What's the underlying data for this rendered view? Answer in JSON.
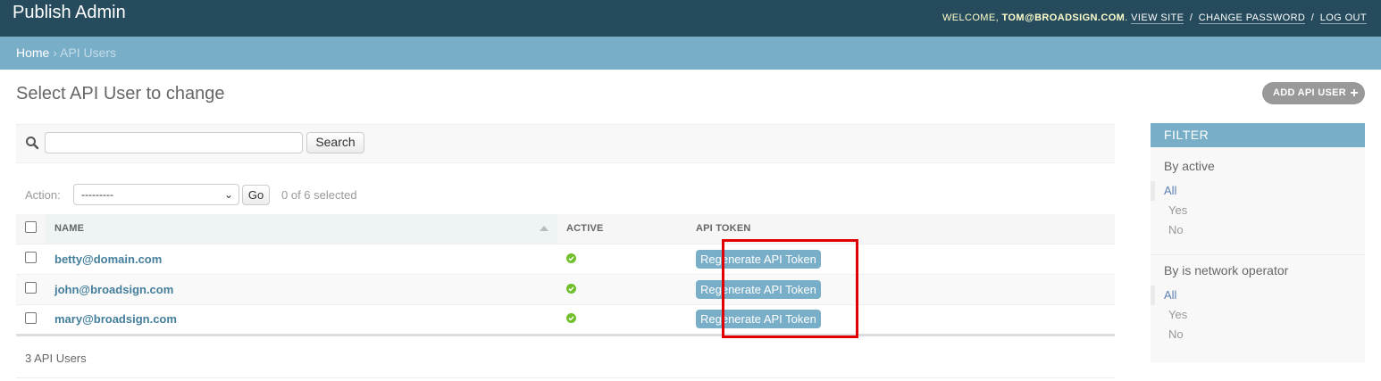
{
  "header": {
    "brand": "Publish Admin",
    "welcome": "WELCOME,",
    "user": "TOM@BROADSIGN.COM",
    "view_site": "VIEW SITE",
    "change_password": "CHANGE PASSWORD",
    "log_out": "LOG OUT",
    "separator": "/"
  },
  "breadcrumbs": {
    "home": "Home",
    "separator": "›",
    "current": "API Users"
  },
  "page": {
    "title": "Select API User to change",
    "add_button": "ADD API USER"
  },
  "toolbar": {
    "search_value": "",
    "search_button": "Search"
  },
  "actions": {
    "label": "Action:",
    "selected_option": "---------",
    "go": "Go",
    "selected_count": "0 of 6 selected"
  },
  "table": {
    "columns": [
      "NAME",
      "ACTIVE",
      "API TOKEN"
    ],
    "rows": [
      {
        "name": "betty@domain.com",
        "active": true,
        "token_button": "Regenerate API Token"
      },
      {
        "name": "john@broadsign.com",
        "active": true,
        "token_button": "Regenerate API Token"
      },
      {
        "name": "mary@broadsign.com",
        "active": true,
        "token_button": "Regenerate API Token"
      }
    ]
  },
  "paginator": {
    "text": "3 API Users"
  },
  "filter": {
    "header": "FILTER",
    "groups": [
      {
        "title": "By active",
        "items": [
          "All",
          "Yes",
          "No"
        ],
        "selected": "All"
      },
      {
        "title": "By is network operator",
        "items": [
          "All",
          "Yes",
          "No"
        ],
        "selected": "All"
      }
    ]
  },
  "colors": {
    "header_bg": "#264b5d",
    "breadcrumb_bg": "#79aec8",
    "link": "#447e9b",
    "button": "#79aec8",
    "active_icon": "#70bf2b",
    "highlight": "#e00000"
  }
}
